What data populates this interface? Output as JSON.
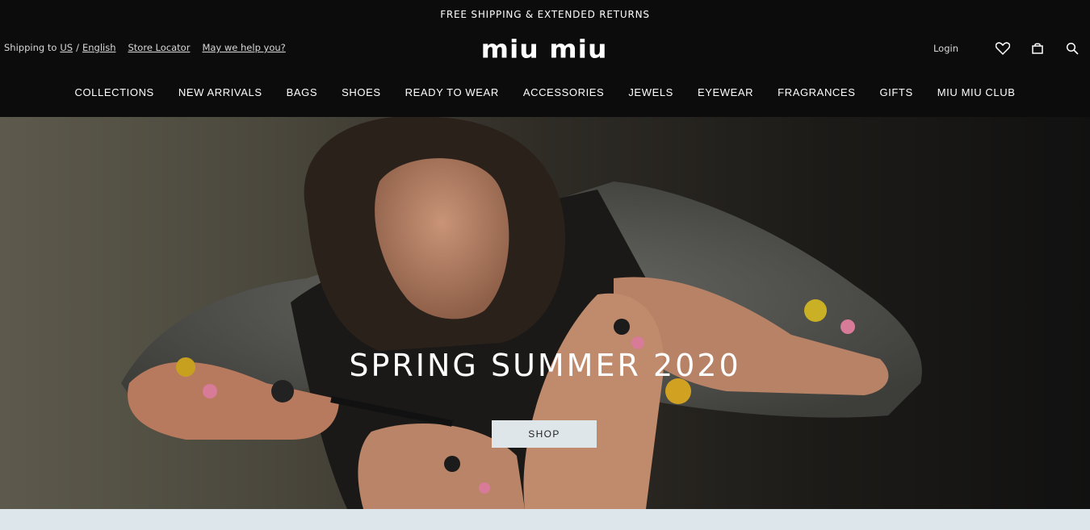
{
  "promo": {
    "text": "FREE SHIPPING & EXTENDED RETURNS"
  },
  "utility_left": {
    "shipping_prefix": "Shipping to",
    "country": "US",
    "separator": "/",
    "language": "English",
    "store_locator": "Store Locator",
    "help": "May we help you?"
  },
  "logo": {
    "text": "miu miu"
  },
  "utility_right": {
    "login": "Login",
    "icons": [
      "heart-icon",
      "bag-icon",
      "search-icon"
    ]
  },
  "nav": {
    "items": [
      "COLLECTIONS",
      "NEW ARRIVALS",
      "BAGS",
      "SHOES",
      "READY TO WEAR",
      "ACCESSORIES",
      "JEWELS",
      "EYEWEAR",
      "FRAGRANCES",
      "GIFTS",
      "MIU MIU CLUB"
    ]
  },
  "hero": {
    "title": "SPRING SUMMER 2020",
    "cta": "SHOP"
  },
  "colors": {
    "header_bg": "#0c0c0c",
    "button_bg": "#dfe6ea",
    "strip_bg": "#dde6eb"
  }
}
